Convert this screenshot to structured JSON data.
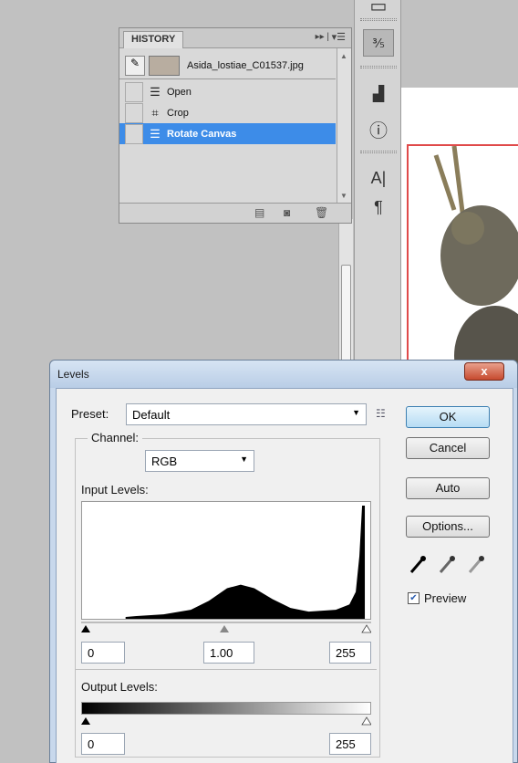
{
  "history_panel": {
    "tab_label": "HISTORY",
    "menu_glyph": "▸▸ |",
    "options_glyph": "▾☰",
    "snapshot_name": "Asida_lostiae_C01537.jpg",
    "steps": [
      {
        "label": "Open",
        "icon": "document-icon",
        "glyph": "☰"
      },
      {
        "label": "Crop",
        "icon": "crop-icon",
        "glyph": "⌗"
      },
      {
        "label": "Rotate Canvas",
        "icon": "document-icon",
        "glyph": "☰",
        "selected": true
      }
    ]
  },
  "dock": {
    "items": [
      "history-icon",
      "histogram-icon",
      "info-icon",
      "character-icon",
      "paragraph-icon"
    ]
  },
  "levels_dialog": {
    "title": "Levels",
    "close_glyph": "x",
    "preset_label": "Preset:",
    "preset_value": "Default",
    "channel_label": "Channel:",
    "channel_value": "RGB",
    "input_levels_label": "Input Levels:",
    "input_black": "0",
    "input_gamma": "1.00",
    "input_white": "255",
    "output_levels_label": "Output Levels:",
    "output_black": "0",
    "output_white": "255",
    "ok_label": "OK",
    "cancel_label": "Cancel",
    "auto_label": "Auto",
    "options_label": "Options...",
    "preview_label": "Preview",
    "preview_checked": true
  },
  "colors": {
    "selection": "#3d8ce8",
    "canvas_border": "#e04a4a",
    "dialog_frame": "#c8d8ec"
  }
}
